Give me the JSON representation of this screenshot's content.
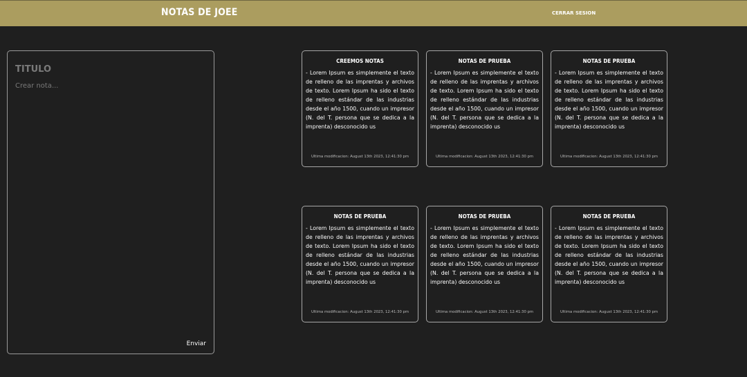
{
  "header": {
    "title": "NOTAS DE JOEE",
    "logout_label": "CERRAR SESION"
  },
  "editor": {
    "title_placeholder": "TITULO",
    "body_placeholder": "Crear nota...",
    "send_label": "Enviar"
  },
  "notes": [
    {
      "title": "CREEMOS NOTAS",
      "body": "- Lorem Ipsum es simplemente el texto de relleno de las imprentas y archivos de texto. Lorem Ipsum ha sido el texto de relleno estándar de las industrias desde el año 1500, cuando un impresor (N. del T. persona que se dedica a la imprenta) desconocido us",
      "modified": "Ultima modificacion: August 13th 2023, 12:41:30 pm"
    },
    {
      "title": "NOTAS DE PRUEBA",
      "body": "- Lorem Ipsum es simplemente el texto de relleno de las imprentas y archivos de texto. Lorem Ipsum ha sido el texto de relleno estándar de las industrias desde el año 1500, cuando un impresor (N. del T. persona que se dedica a la imprenta) desconocido us",
      "modified": "Ultima modificacion: August 13th 2023, 12:41:30 pm"
    },
    {
      "title": "NOTAS DE PRUEBA",
      "body": "- Lorem Ipsum es simplemente el texto de relleno de las imprentas y archivos de texto. Lorem Ipsum ha sido el texto de relleno estándar de las industrias desde el año 1500, cuando un impresor (N. del T. persona que se dedica a la imprenta) desconocido us",
      "modified": "Ultima modificacion: August 13th 2023, 12:41:30 pm"
    },
    {
      "title": "NOTAS DE PRUEBA",
      "body": "- Lorem Ipsum es simplemente el texto de relleno de las imprentas y archivos de texto. Lorem Ipsum ha sido el texto de relleno estándar de las industrias desde el año 1500, cuando un impresor (N. del T. persona que se dedica a la imprenta) desconocido us",
      "modified": "Ultima modificacion: August 13th 2023, 12:41:30 pm"
    },
    {
      "title": "NOTAS DE PRUEBA",
      "body": "- Lorem Ipsum es simplemente el texto de relleno de las imprentas y archivos de texto. Lorem Ipsum ha sido el texto de relleno estándar de las industrias desde el año 1500, cuando un impresor (N. del T. persona que se dedica a la imprenta) desconocido us",
      "modified": "Ultima modificacion: August 13th 2023, 12:41:30 pm"
    },
    {
      "title": "NOTAS DE PRUEBA",
      "body": "- Lorem Ipsum es simplemente el texto de relleno de las imprentas y archivos de texto. Lorem Ipsum ha sido el texto de relleno estándar de las industrias desde el año 1500, cuando un impresor (N. del T. persona que se dedica a la imprenta) desconocido us",
      "modified": "Ultima modificacion: August 13th 2023, 12:41:30 pm"
    }
  ],
  "colors": {
    "background": "#1f1f1f",
    "header": "#ab9d5f",
    "border": "#a8a8a8",
    "text": "#ffffff"
  }
}
